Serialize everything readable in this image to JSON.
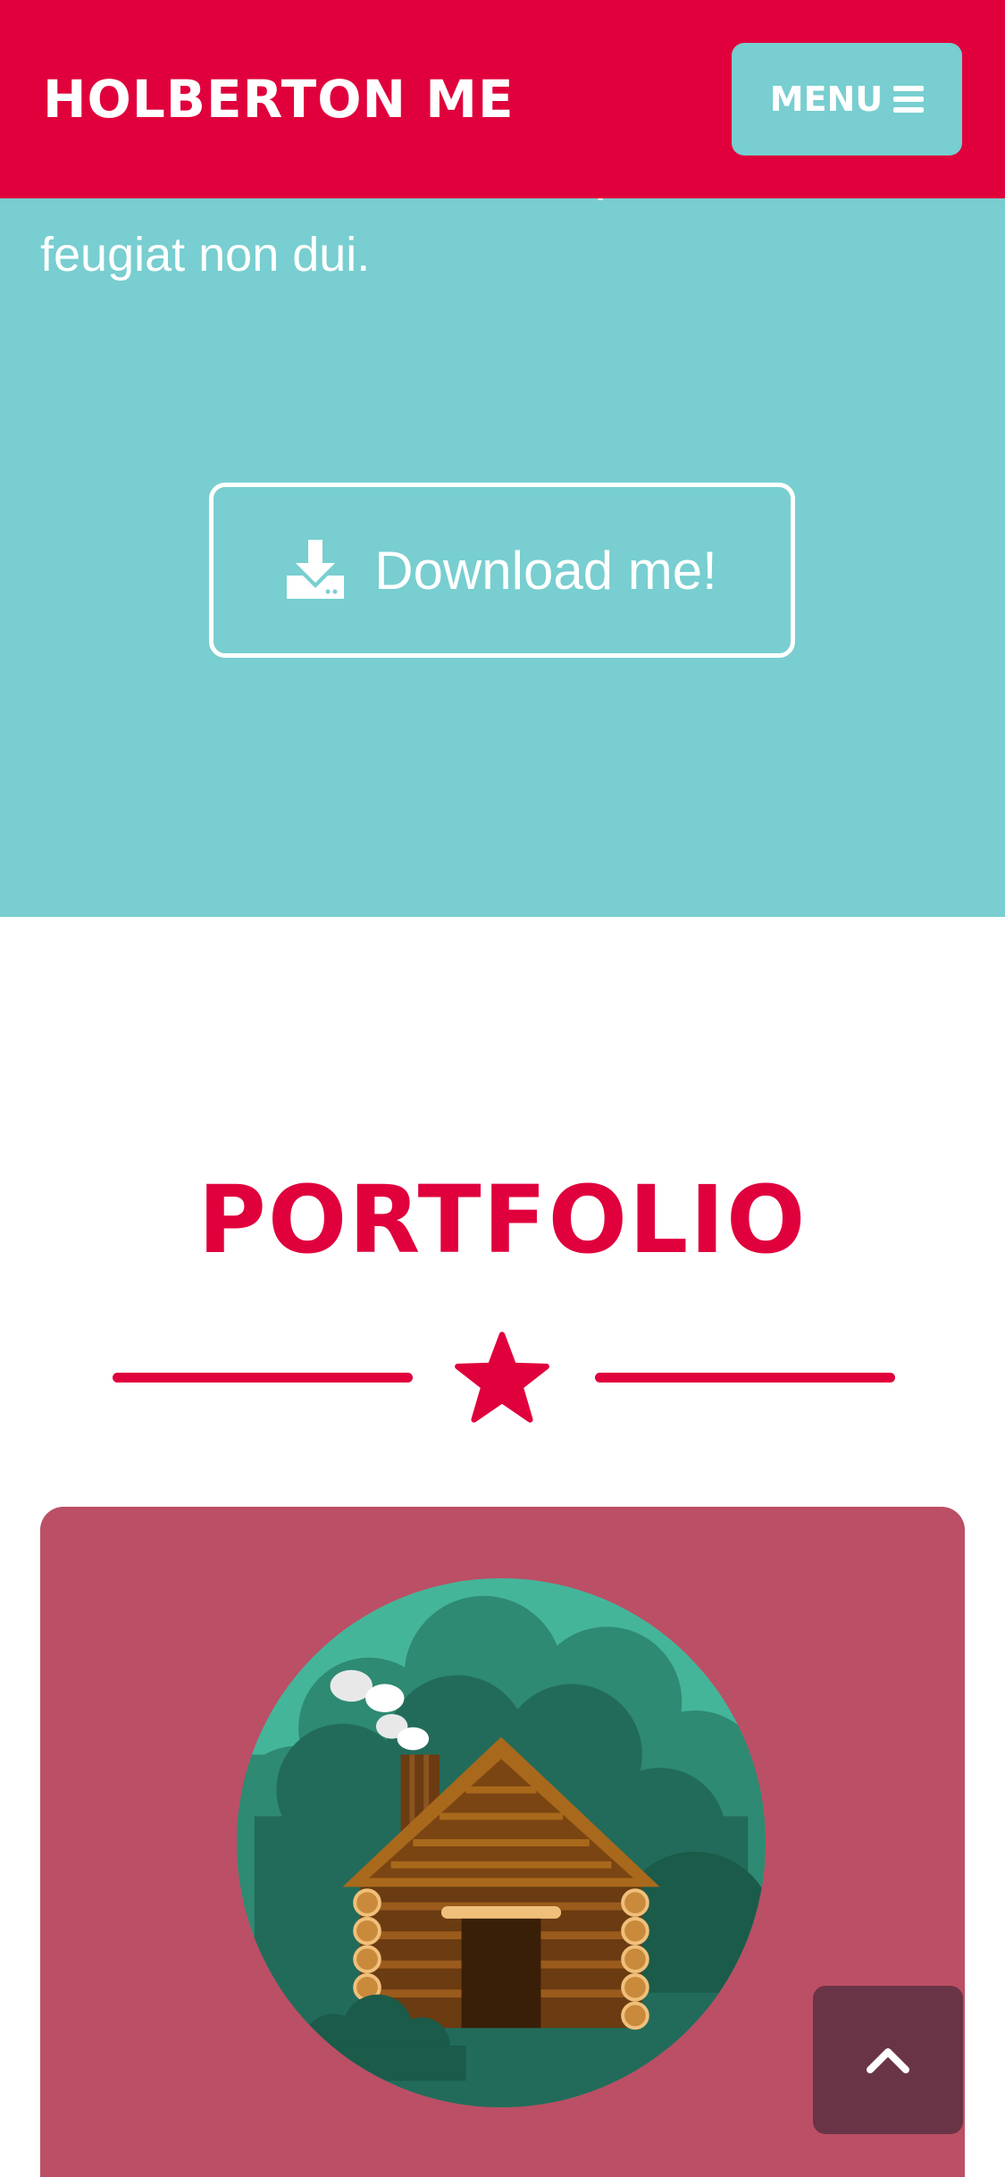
{
  "navbar": {
    "brand": "HOLBERTON ME",
    "menu_label": "MENU",
    "menu_icon": "bars-icon"
  },
  "colors": {
    "primary": "#e0003c",
    "teal": "#78ced0",
    "card": "#bb4f65",
    "back_to_top": "#6a3447",
    "white": "#ffffff"
  },
  "about": {
    "text_lines": [
      "ante mi, mollis at scelerisque nec,",
      "feugiat non dui."
    ],
    "download_label": "Download me!",
    "download_icon": "download-icon"
  },
  "portfolio": {
    "title": "PORTFOLIO",
    "divider_icon": "star-icon",
    "items": [
      {
        "image": "log-cabin-illustration"
      }
    ]
  },
  "back_to_top": {
    "icon": "chevron-up-icon"
  }
}
